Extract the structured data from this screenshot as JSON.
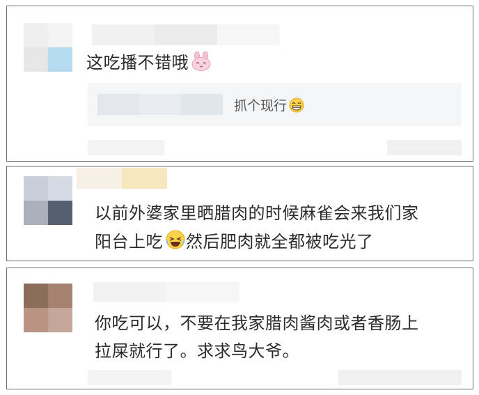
{
  "comments": [
    {
      "text": "这吃播不错哦",
      "emoji": "bunny-face-icon",
      "reply": {
        "text": "抓个现行",
        "emoji": "grinning-face-icon"
      }
    },
    {
      "line1": "以前外婆家里晒腊肉的时候麻雀会来我们家",
      "line2a": "阳台上吃",
      "emoji": "laughing-crying-face-icon",
      "line2b": "然后肥肉就全都被吃光了"
    },
    {
      "line1": "你吃可以，不要在我家腊肉酱肉或者香肠上",
      "line2": "拉屎就行了。求求鸟大爷。"
    }
  ],
  "colors": {
    "border": "#6e6e6e",
    "text": "#2b2b2b",
    "reply_bg": "#f4f5f7"
  }
}
